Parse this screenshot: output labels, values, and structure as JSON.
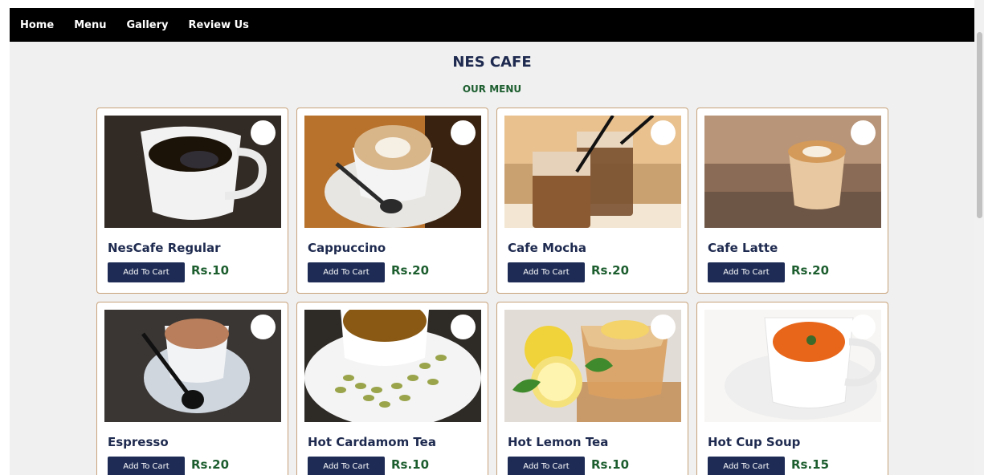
{
  "nav": {
    "items": [
      {
        "label": "Home"
      },
      {
        "label": "Menu"
      },
      {
        "label": "Gallery"
      },
      {
        "label": "Review Us"
      }
    ]
  },
  "header": {
    "title": "NES CAFE",
    "subtitle": "OUR MENU"
  },
  "menu": {
    "add_label": "Add To Cart",
    "items": [
      {
        "name": "NesCafe Regular",
        "price": "Rs.10",
        "image": "black-coffee-cup"
      },
      {
        "name": "Cappuccino",
        "price": "Rs.20",
        "image": "cappuccino-latte-art"
      },
      {
        "name": "Cafe Mocha",
        "price": "Rs.20",
        "image": "iced-mocha-glasses"
      },
      {
        "name": "Cafe Latte",
        "price": "Rs.20",
        "image": "latte-glass"
      },
      {
        "name": "Espresso",
        "price": "Rs.20",
        "image": "milk-coffee-cup"
      },
      {
        "name": "Hot Cardamom Tea",
        "price": "Rs.10",
        "image": "tea-with-cardamom"
      },
      {
        "name": "Hot Lemon Tea",
        "price": "Rs.10",
        "image": "lemon-tea-glass"
      },
      {
        "name": "Hot Cup Soup",
        "price": "Rs.15",
        "image": "tomato-soup-cup"
      }
    ]
  },
  "colors": {
    "nav_bg": "#000000",
    "title": "#1e2a4f",
    "price": "#1d5e2f",
    "button_bg": "#1d2b55",
    "card_border": "#c8a27a"
  }
}
